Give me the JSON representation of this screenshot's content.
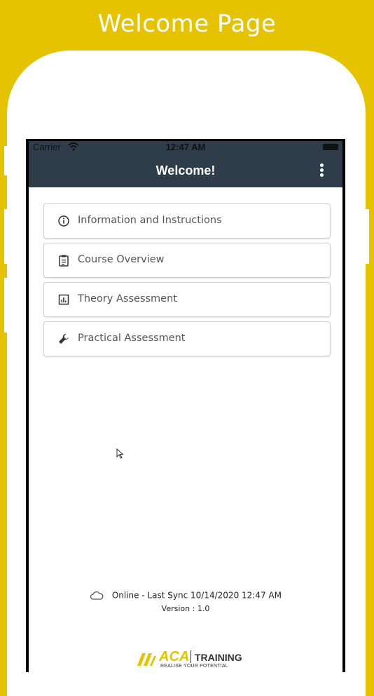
{
  "headline": "Welcome Page",
  "status_bar": {
    "carrier": "Carrier",
    "time": "12:47 AM"
  },
  "nav": {
    "title": "Welcome!"
  },
  "menu_items": [
    {
      "label": "Information and Instructions",
      "icon": "info-icon"
    },
    {
      "label": "Course Overview",
      "icon": "clipboard-icon"
    },
    {
      "label": "Theory Assessment",
      "icon": "bar-chart-icon"
    },
    {
      "label": "Practical Assessment",
      "icon": "wrench-icon"
    }
  ],
  "footer": {
    "sync_status": "Online - Last Sync 10/14/2020 12:47 AM",
    "version": "Version : 1.0"
  },
  "logo": {
    "brand": "ACA",
    "product": "TRAINING",
    "tagline": "REALISE YOUR POTENTIAL"
  },
  "colors": {
    "background": "#e6c300",
    "nav_bar": "#2f3d4b",
    "accent": "#e6c300"
  }
}
